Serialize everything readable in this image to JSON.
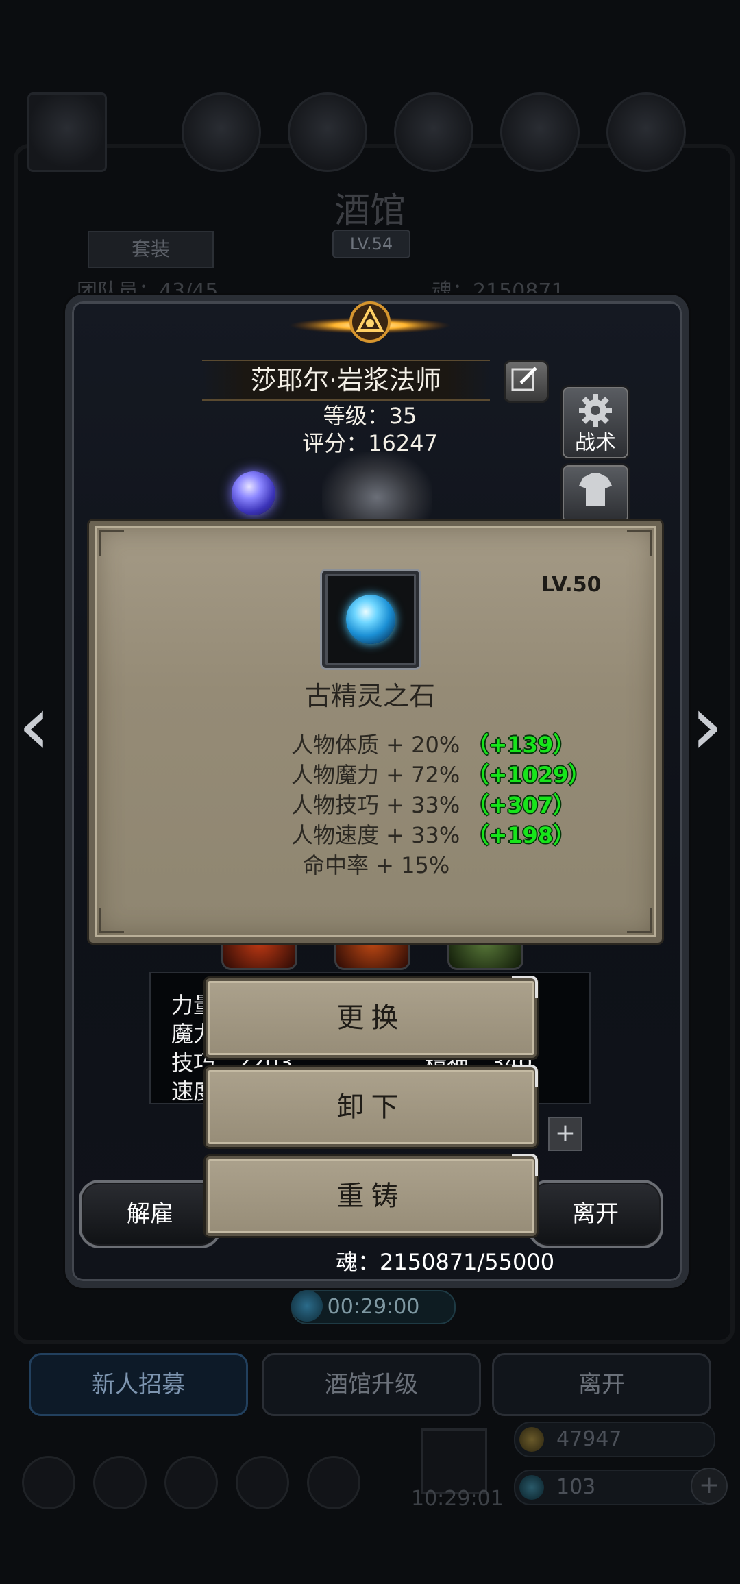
{
  "background": {
    "title": "酒馆",
    "level": "LV.54",
    "set_tab": "套装",
    "roster": "团队员：43/45",
    "soul_top": "魂：2150871",
    "timer": "00:29:00",
    "bottom_buttons": [
      "新人招募",
      "酒馆升级",
      "离开"
    ],
    "resource_gold": "47947",
    "resource_gem": "103",
    "gift_timer": "10:29:01"
  },
  "hero": {
    "name": "莎耶尔·岩浆法师",
    "level": "等级：35",
    "score": "评分：16247",
    "side_buttons": {
      "tactics": "战术",
      "skin": "皮肤"
    },
    "stats": [
      "力量",
      "魔力",
      "技巧：2203",
      "速度"
    ],
    "stat_right": "精神：340",
    "soul": "魂：2150871/55000",
    "dismiss": "解雇",
    "leave": "离开",
    "plus": "+"
  },
  "item_popup": {
    "level": "LV.50",
    "name": "古精灵之石",
    "stats": [
      {
        "text": "人物体质 + 20%",
        "bonus": "（+139）"
      },
      {
        "text": "人物魔力 + 72%",
        "bonus": "（+1029）"
      },
      {
        "text": "人物技巧 + 33%",
        "bonus": "（+307）"
      },
      {
        "text": "人物速度 + 33%",
        "bonus": "（+198）"
      },
      {
        "text": "命中率 + 15%",
        "bonus": ""
      }
    ]
  },
  "actions": {
    "replace": "更换",
    "unequip": "卸下",
    "recast": "重铸"
  },
  "nav": {
    "prev": "‹",
    "next": "›"
  }
}
